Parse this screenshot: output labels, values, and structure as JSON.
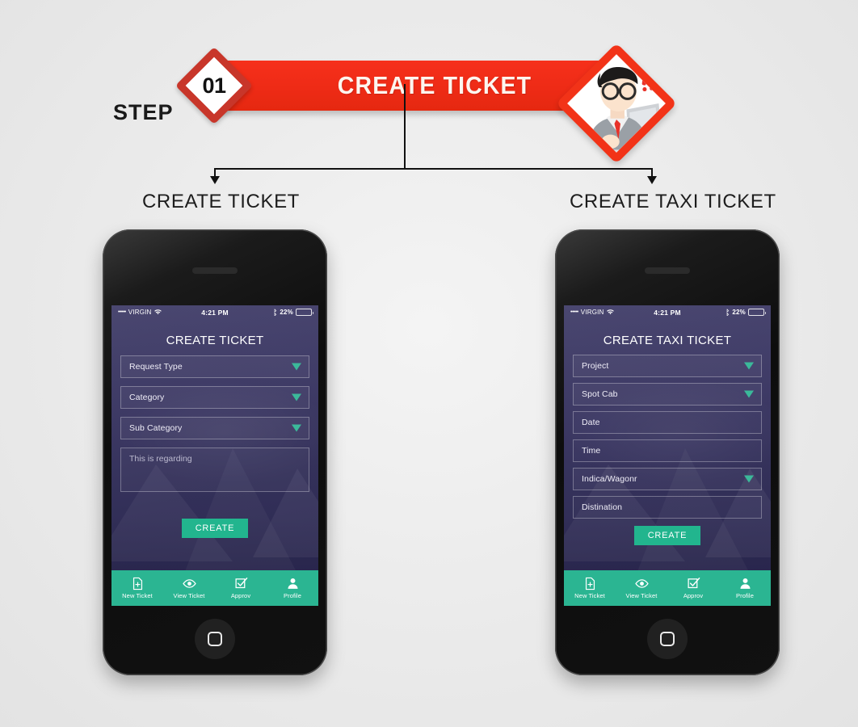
{
  "header": {
    "step_word": "STEP",
    "step_number": "01",
    "banner_title": "CREATE TICKET",
    "character_icon": "man-with-glasses-at-computer-icon",
    "alert_icon": "exclamation-marks-icon"
  },
  "branches": {
    "left_label": "CREATE TICKET",
    "right_label": "CREATE TAXI TICKET"
  },
  "colors": {
    "banner_red": "#ee2b16",
    "diamond_border_red": "#c8362a",
    "accent_teal": "#2bb592",
    "button_teal": "#22b58e",
    "screen_purple": "#433f6b",
    "page_background": "#e8e8e8"
  },
  "status_bar": {
    "signal_dots": "•••••",
    "carrier": "VIRGIN",
    "wifi_icon": "wifi-icon",
    "time": "4:21 PM",
    "bluetooth_icon": "bluetooth-icon",
    "battery_percent": "22%",
    "battery_icon": "battery-icon"
  },
  "phone_left": {
    "name": "create-ticket-phone",
    "screen_title": "CREATE TICKET",
    "fields": [
      {
        "label": "Request Type",
        "type": "dropdown"
      },
      {
        "label": "Category",
        "type": "dropdown"
      },
      {
        "label": "Sub Category",
        "type": "dropdown"
      }
    ],
    "textarea_placeholder": "This is regarding",
    "submit_label": "CREATE"
  },
  "phone_right": {
    "name": "create-taxi-ticket-phone",
    "screen_title": "CREATE  TAXI TICKET",
    "fields": [
      {
        "label": "Project",
        "type": "dropdown"
      },
      {
        "label": "Spot Cab",
        "type": "dropdown"
      },
      {
        "label": "Date",
        "type": "text"
      },
      {
        "label": "Time",
        "type": "text"
      },
      {
        "label": "Indica/Wagonr",
        "type": "dropdown"
      },
      {
        "label": "Distination",
        "type": "text"
      }
    ],
    "submit_label": "CREATE"
  },
  "tabbar": {
    "items": [
      {
        "label": "New Ticket",
        "icon": "new-ticket-icon"
      },
      {
        "label": "View Ticket",
        "icon": "eye-icon"
      },
      {
        "label": "Approv",
        "icon": "checkbox-check-icon"
      },
      {
        "label": "Profile",
        "icon": "person-icon"
      }
    ]
  },
  "home_button": {
    "icon": "home-square-icon"
  }
}
